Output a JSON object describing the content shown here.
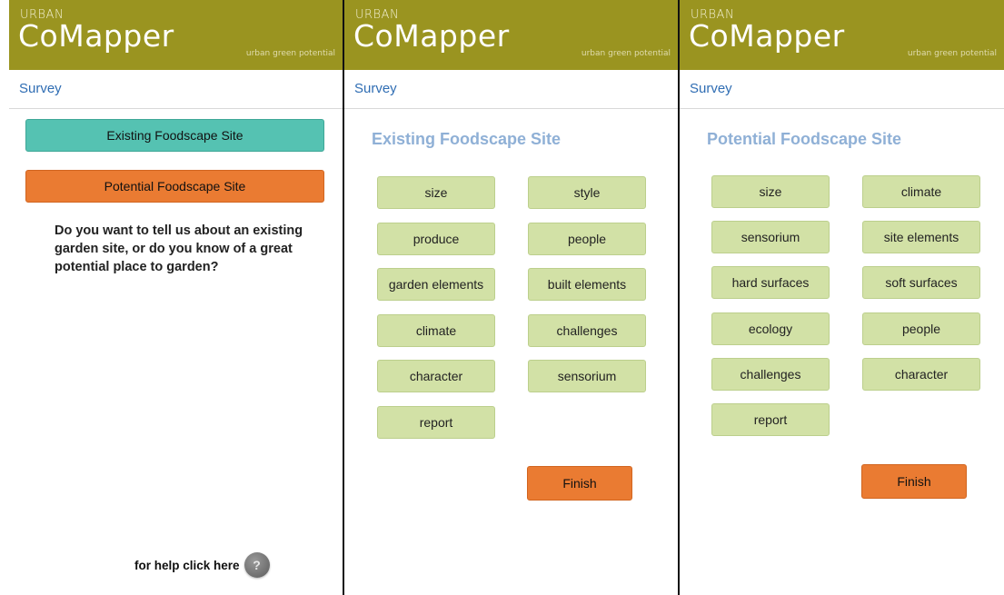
{
  "brand": {
    "small_text": "URBAN",
    "logo_prefix": "Co",
    "logo_rest": "Mapper",
    "tagline": "urban green potential"
  },
  "nav": {
    "survey_label": "Survey"
  },
  "panel1": {
    "existing_button": "Existing Foodscape Site",
    "potential_button": "Potential Foodscape Site",
    "question": "Do you want to tell us about an existing garden site, or do you know of a great potential place to garden?",
    "help_text": "for help click here",
    "help_icon_glyph": "?"
  },
  "panel2": {
    "title": "Existing Foodscape Site",
    "categories": [
      "size",
      "style",
      "produce",
      "people",
      "garden elements",
      "built elements",
      "climate",
      "challenges",
      "character",
      "sensorium",
      "report"
    ],
    "finish_label": "Finish"
  },
  "panel3": {
    "title": "Potential Foodscape Site",
    "categories": [
      "size",
      "climate",
      "sensorium",
      "site elements",
      "hard surfaces",
      "soft surfaces",
      "ecology",
      "people",
      "challenges",
      "character",
      "report"
    ],
    "finish_label": "Finish"
  },
  "colors": {
    "brand_bar": "#9a9420",
    "existing_teal": "#55c2b2",
    "potential_orange": "#ea7b32",
    "category_green": "#d2e1a6",
    "title_blue": "#8fb0d6",
    "nav_link_blue": "#2f6db3"
  },
  "icons": {
    "help": "help-question-icon"
  }
}
